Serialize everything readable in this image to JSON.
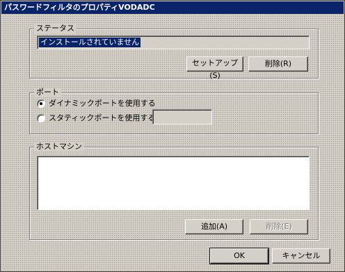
{
  "window": {
    "title": "パスワードフィルタのプロパティVODADC"
  },
  "status_group": {
    "legend": "ステータス",
    "status_text": "インストールされていません",
    "setup_label": "セットアップ(S)",
    "remove_label": "削除(R)"
  },
  "port_group": {
    "legend": "ポート",
    "dynamic_label": "ダイナミックポートを使用する",
    "static_label": "スタティックポートを使用する",
    "selected": "dynamic",
    "static_port_value": ""
  },
  "host_group": {
    "legend": "ホストマシン",
    "add_label": "追加(A)",
    "remove_label": "削除(E)"
  },
  "footer": {
    "ok_label": "OK",
    "cancel_label": "キャンセル"
  }
}
